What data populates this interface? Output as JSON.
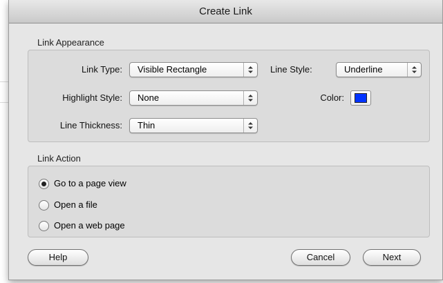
{
  "dialog": {
    "title": "Create Link",
    "link_appearance": {
      "group_label": "Link Appearance",
      "link_type": {
        "label": "Link Type:",
        "value": "Visible Rectangle"
      },
      "line_style": {
        "label": "Line Style:",
        "value": "Underline"
      },
      "highlight_style": {
        "label": "Highlight Style:",
        "value": "None"
      },
      "color": {
        "label": "Color:",
        "swatch": "#0033ff"
      },
      "line_thickness": {
        "label": "Line Thickness:",
        "value": "Thin"
      }
    },
    "link_action": {
      "group_label": "Link Action",
      "options": [
        {
          "label": "Go to a page view",
          "checked": true
        },
        {
          "label": "Open a file",
          "checked": false
        },
        {
          "label": "Open a web page",
          "checked": false
        }
      ]
    },
    "buttons": {
      "help": "Help",
      "cancel": "Cancel",
      "next": "Next"
    }
  }
}
